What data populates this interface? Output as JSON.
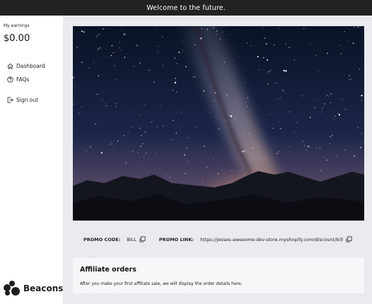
{
  "banner": {
    "text": "Welcome to the future."
  },
  "sidebar": {
    "earnings_label": "My earnings",
    "earnings_value": "$0.00",
    "items": [
      {
        "label": "Dashboard",
        "icon": "home-icon"
      },
      {
        "label": "FAQs",
        "icon": "question-circle-icon"
      },
      {
        "label": "Sign out",
        "icon": "sign-out-icon"
      }
    ],
    "brand": "Beacons"
  },
  "promo": {
    "code_label": "PROMO CODE:",
    "code_value": "BILL",
    "link_label": "PROMO LINK:",
    "link_value": "https://jesses-awesome-dev-store.myshopify.com/discount/bill"
  },
  "orders": {
    "title": "Affiliate orders",
    "message": "After you make your first affiliate sale, we will display the order details here."
  },
  "colors": {
    "banner_bg": "#222222",
    "page_bg": "#e9ebef",
    "card_bg": "#f6f7f9"
  }
}
